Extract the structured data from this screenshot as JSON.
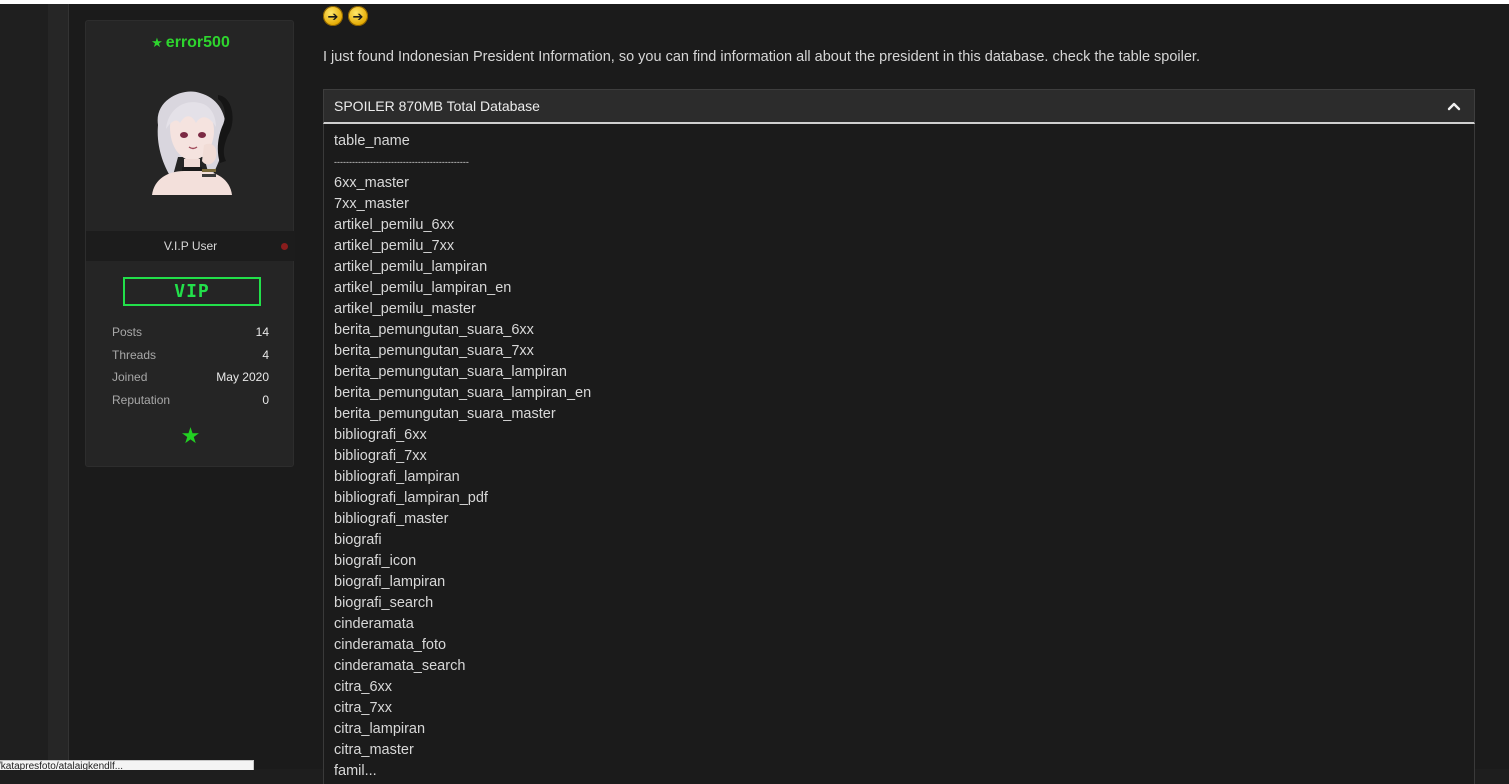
{
  "user": {
    "username": "error500",
    "rank": "V.I.P User",
    "badge": "VIP",
    "stats": [
      {
        "label": "Posts",
        "value": "14"
      },
      {
        "label": "Threads",
        "value": "4"
      },
      {
        "label": "Joined",
        "value": "May 2020"
      },
      {
        "label": "Reputation",
        "value": "0"
      }
    ]
  },
  "post": {
    "message": "I just found Indonesian President Information, so you can find information all about the president in this database. check the table spoiler.",
    "spoiler": {
      "title": "SPOILER 870MB Total Database",
      "lines": [
        "table_name",
        "---------------------------------------------",
        "6xx_master",
        "7xx_master",
        "artikel_pemilu_6xx",
        "artikel_pemilu_7xx",
        "artikel_pemilu_lampiran",
        "artikel_pemilu_lampiran_en",
        "artikel_pemilu_master",
        "berita_pemungutan_suara_6xx",
        "berita_pemungutan_suara_7xx",
        "berita_pemungutan_suara_lampiran",
        "berita_pemungutan_suara_lampiran_en",
        "berita_pemungutan_suara_master",
        "bibliografi_6xx",
        "bibliografi_7xx",
        "bibliografi_lampiran",
        "bibliografi_lampiran_pdf",
        "bibliografi_master",
        "biografi",
        "biografi_icon",
        "biografi_lampiran",
        "biografi_search",
        "cinderamata",
        "cinderamata_foto",
        "cinderamata_search",
        "citra_6xx",
        "citra_7xx",
        "citra_lampiran",
        "citra_master",
        "famil..."
      ]
    }
  },
  "statusbar": {
    "text": "/katapresfoto/atalaigkendlf..."
  },
  "colors": {
    "accent_green": "#22e04a",
    "username_green": "#2ed42e",
    "offline_dot": "#8a1d1d"
  },
  "icons": {
    "username": "star-icon",
    "award": "star-icon",
    "nav": [
      "arrow-right-icon",
      "arrow-right-icon"
    ],
    "spoiler_toggle": "chevron-up-icon"
  }
}
